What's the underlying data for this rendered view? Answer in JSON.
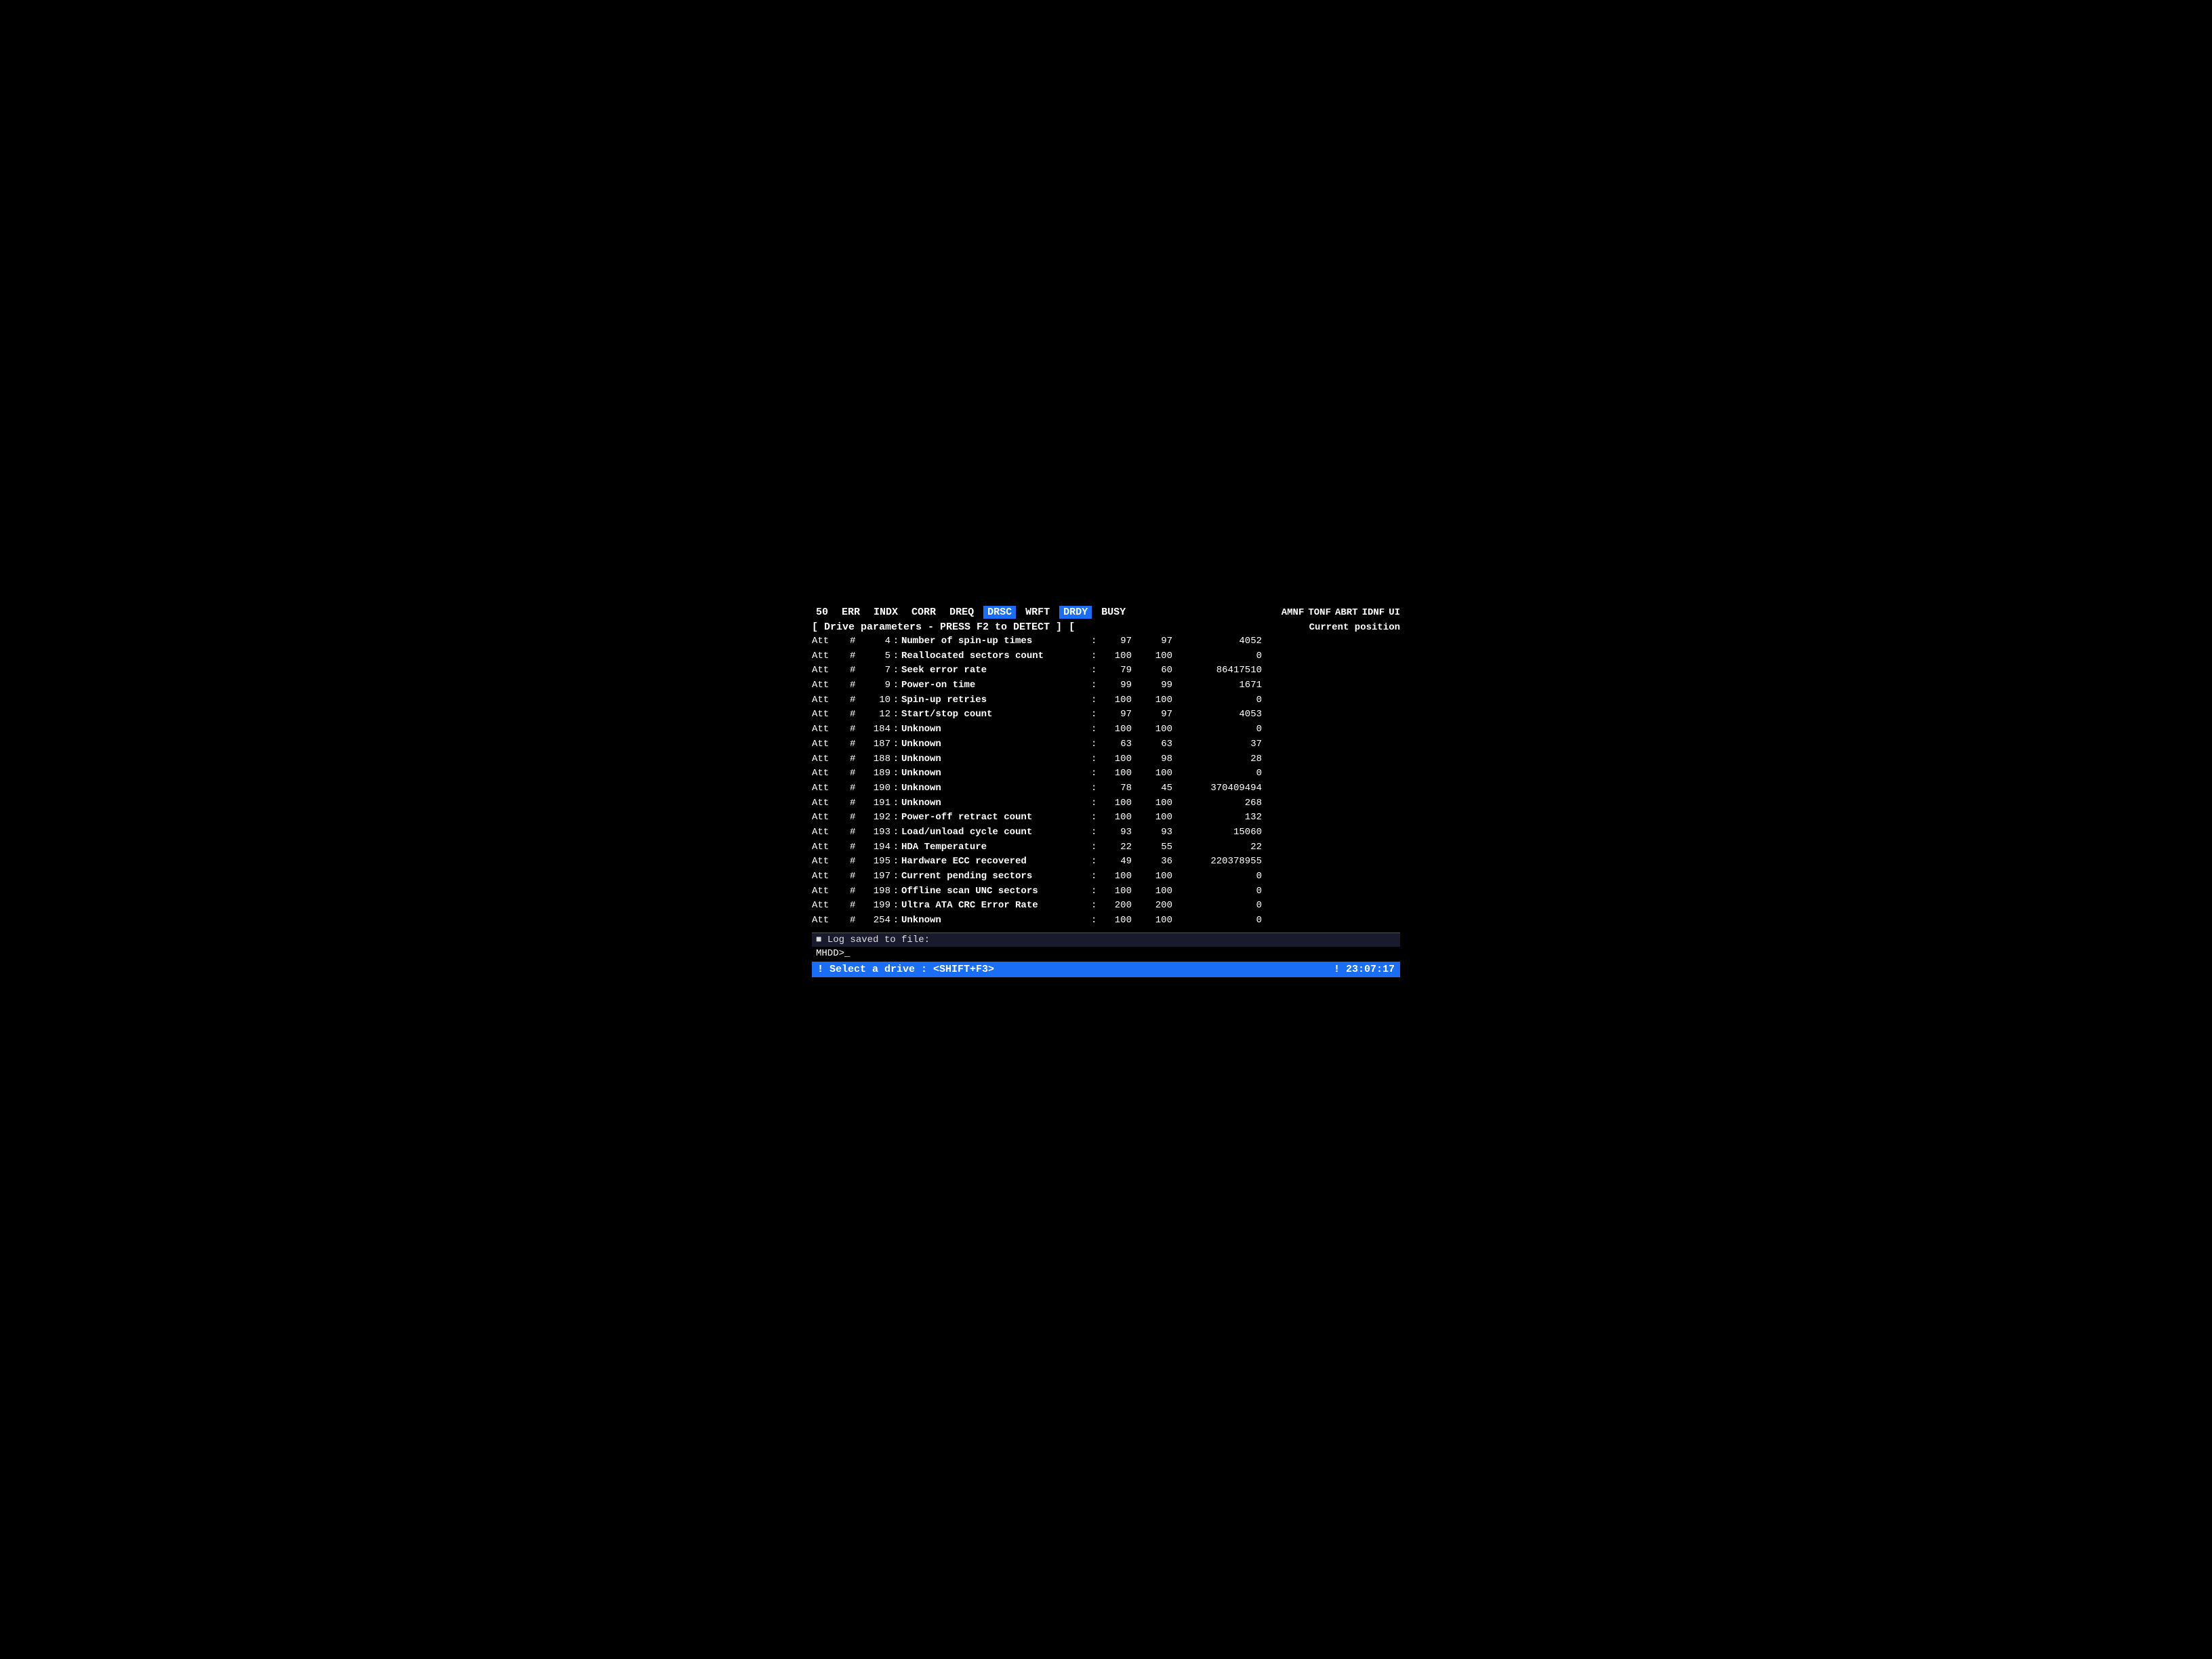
{
  "topbar": {
    "items": [
      "50",
      "ERR",
      "INDX",
      "CORR",
      "DREQ",
      "DRSC",
      "WRFT",
      "DRDY",
      "BUSY"
    ],
    "active": [
      "DRSC",
      "DRDY"
    ],
    "right_items": [
      "AMNF",
      "TONF",
      "ABRT",
      "IDNF",
      "UI"
    ]
  },
  "drive_params": {
    "label": "[ Drive parameters - PRESS F2 to DETECT ]",
    "bracket_right": "[",
    "current_position": "Current position"
  },
  "attributes": [
    {
      "att": "Att",
      "hash": "#",
      "num": "4",
      "name": "Number of spin-up times",
      "val1": "97",
      "val2": "97",
      "val3": "4052"
    },
    {
      "att": "Att",
      "hash": "#",
      "num": "5",
      "name": "Reallocated sectors count",
      "val1": "100",
      "val2": "100",
      "val3": "0"
    },
    {
      "att": "Att",
      "hash": "#",
      "num": "7",
      "name": "Seek error rate",
      "val1": "79",
      "val2": "60",
      "val3": "86417510"
    },
    {
      "att": "Att",
      "hash": "#",
      "num": "9",
      "name": "Power-on time",
      "val1": "99",
      "val2": "99",
      "val3": "1671"
    },
    {
      "att": "Att",
      "hash": "#",
      "num": "10",
      "name": "Spin-up retries",
      "val1": "100",
      "val2": "100",
      "val3": "0"
    },
    {
      "att": "Att",
      "hash": "#",
      "num": "12",
      "name": "Start/stop count",
      "val1": "97",
      "val2": "97",
      "val3": "4053"
    },
    {
      "att": "Att",
      "hash": "#",
      "num": "184",
      "name": "Unknown",
      "val1": "100",
      "val2": "100",
      "val3": "0"
    },
    {
      "att": "Att",
      "hash": "#",
      "num": "187",
      "name": "Unknown",
      "val1": "63",
      "val2": "63",
      "val3": "37"
    },
    {
      "att": "Att",
      "hash": "#",
      "num": "188",
      "name": "Unknown",
      "val1": "100",
      "val2": "98",
      "val3": "28"
    },
    {
      "att": "Att",
      "hash": "#",
      "num": "189",
      "name": "Unknown",
      "val1": "100",
      "val2": "100",
      "val3": "0"
    },
    {
      "att": "Att",
      "hash": "#",
      "num": "190",
      "name": "Unknown",
      "val1": "78",
      "val2": "45",
      "val3": "370409494"
    },
    {
      "att": "Att",
      "hash": "#",
      "num": "191",
      "name": "Unknown",
      "val1": "100",
      "val2": "100",
      "val3": "268"
    },
    {
      "att": "Att",
      "hash": "#",
      "num": "192",
      "name": "Power-off retract count",
      "val1": "100",
      "val2": "100",
      "val3": "132"
    },
    {
      "att": "Att",
      "hash": "#",
      "num": "193",
      "name": "Load/unload cycle count",
      "val1": "93",
      "val2": "93",
      "val3": "15060"
    },
    {
      "att": "Att",
      "hash": "#",
      "num": "194",
      "name": "HDA Temperature",
      "val1": "22",
      "val2": "55",
      "val3": "22"
    },
    {
      "att": "Att",
      "hash": "#",
      "num": "195",
      "name": "Hardware ECC recovered",
      "val1": "49",
      "val2": "36",
      "val3": "220378955"
    },
    {
      "att": "Att",
      "hash": "#",
      "num": "197",
      "name": "Current pending sectors",
      "val1": "100",
      "val2": "100",
      "val3": "0"
    },
    {
      "att": "Att",
      "hash": "#",
      "num": "198",
      "name": "Offline scan UNC sectors",
      "val1": "100",
      "val2": "100",
      "val3": "0"
    },
    {
      "att": "Att",
      "hash": "#",
      "num": "199",
      "name": "Ultra ATA CRC Error Rate",
      "val1": "200",
      "val2": "200",
      "val3": "0"
    },
    {
      "att": "Att",
      "hash": "#",
      "num": "254",
      "name": "Unknown",
      "val1": "100",
      "val2": "100",
      "val3": "0"
    }
  ],
  "log_bar": {
    "square": "■",
    "text": "Log saved to file:"
  },
  "prompt": "MHDD>_",
  "status_bar": {
    "left": "! Select a drive : <SHIFT+F3>",
    "right": "! 23:07:17"
  }
}
